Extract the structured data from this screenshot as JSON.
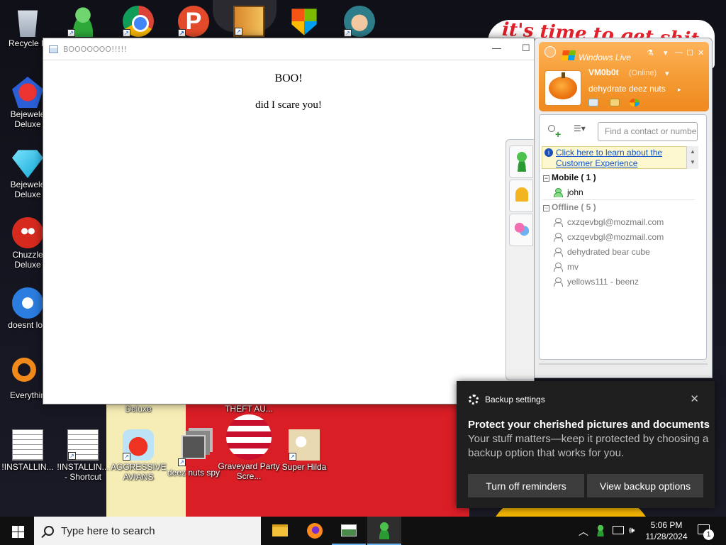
{
  "desktop": {
    "wallpaper_text": "it's time to get shit",
    "icons": [
      {
        "id": "recycle",
        "label": "Recycle B"
      },
      {
        "id": "msn",
        "label": ""
      },
      {
        "id": "chrome",
        "label": ""
      },
      {
        "id": "p",
        "label": ""
      },
      {
        "id": "door",
        "label": ""
      },
      {
        "id": "win",
        "label": ""
      },
      {
        "id": "char",
        "label": ""
      },
      {
        "id": "bejeweled2",
        "label": "Bejewele Deluxe"
      },
      {
        "id": "bejeweled",
        "label": "Bejewele Deluxe"
      },
      {
        "id": "chuzzle",
        "label": "Chuzzle Deluxe"
      },
      {
        "id": "thunderbird",
        "label": "doesnt loa"
      },
      {
        "id": "everything",
        "label": "Everythin"
      },
      {
        "id": "install1",
        "label": "!INSTALLIN..."
      },
      {
        "id": "install2",
        "label": "!INSTALLIN... - Shortcut"
      },
      {
        "id": "angry",
        "label": "AGGRESSIVE AVIANS"
      },
      {
        "id": "deeznuts",
        "label": "deez nuts spy"
      },
      {
        "id": "graveyard",
        "label": "Graveyard Party Scre..."
      },
      {
        "id": "hilda",
        "label": "Super Hilda"
      },
      {
        "id": "deluxe-peek",
        "label": "Deluxe"
      },
      {
        "id": "theft",
        "label": "THEFT AU..."
      }
    ]
  },
  "boo_window": {
    "title": "BOOOOOOO!!!!!",
    "heading": "BOO!",
    "message": "did I scare you!",
    "minimize_glyph": "—",
    "maximize_glyph": "☐"
  },
  "messenger": {
    "brand": "Windows Live",
    "user_name": "VM0b0t",
    "user_status": "(Online)",
    "personal_message": "dehydrate deez nuts",
    "search_placeholder": "Find a contact or number...",
    "info_link": "Click here to learn about the Customer Experience",
    "groups": [
      {
        "name": "Mobile ( 1 )",
        "contacts": [
          "john"
        ]
      },
      {
        "name": "Offline ( 5 )",
        "contacts": [
          "cxzqevbgl@mozmail.com",
          "cxzqevbgl@mozmail.com",
          "dehydrated bear cube",
          "mv",
          "yellows111 - beenz"
        ]
      }
    ]
  },
  "toast": {
    "app": "Backup settings",
    "title": "Protect your cherished pictures and documents",
    "body": "Your stuff matters—keep it protected by choosing a backup option that works for you.",
    "btn_off": "Turn off reminders",
    "btn_view": "View backup options",
    "close_glyph": "✕"
  },
  "taskbar": {
    "search_placeholder": "Type here to search",
    "time": "5:06 PM",
    "date": "11/28/2024",
    "notification_count": "1",
    "tray_chevron": "︿"
  }
}
